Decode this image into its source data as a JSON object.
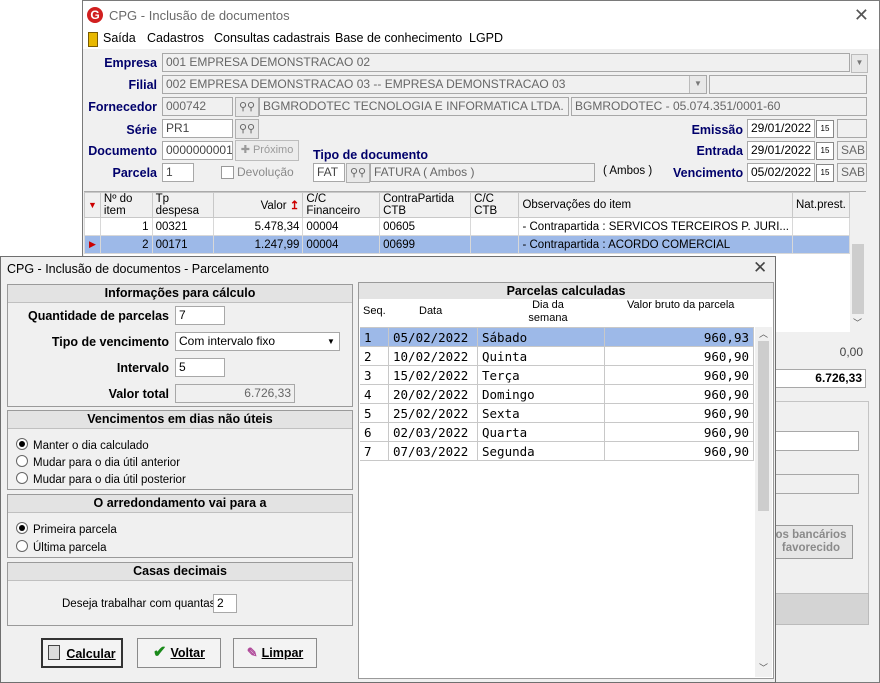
{
  "main": {
    "title": "CPG - Inclusão de documentos",
    "menu": [
      "Saída",
      "Cadastros",
      "Consultas cadastrais",
      "Base de conhecimento",
      "LGPD"
    ],
    "empresa_label": "Empresa",
    "empresa_value": "001 EMPRESA DEMONSTRACAO 02",
    "filial_label": "Filial",
    "filial_value": "002 EMPRESA DEMONSTRACAO 03 -- EMPRESA DEMONSTRACAO 03",
    "fornecedor_label": "Fornecedor",
    "fornecedor_code": "000742",
    "fornecedor_name": "BGMRODOTEC TECNOLOGIA E INFORMATICA LTDA.",
    "fornecedor_doc": "BGMRODOTEC - 05.074.351/0001-60",
    "serie_label": "Série",
    "serie_value": "PR1",
    "documento_label": "Documento",
    "documento_value": "0000000001",
    "proximo_label": "Próximo",
    "parcela_label": "Parcela",
    "parcela_value": "1",
    "devolucao_label": "Devolução",
    "tipo_doc_label": "Tipo de documento",
    "tipo_doc_code": "FAT",
    "tipo_doc_name": "FATURA ( Ambos )",
    "tipo_doc_extra": "( Ambos )",
    "emissao_label": "Emissão",
    "emissao_value": "29/01/2022",
    "entrada_label": "Entrada",
    "entrada_value": "29/01/2022",
    "entrada_day": "SAB",
    "vencimento_label": "Vencimento",
    "vencimento_value": "05/02/2022",
    "vencimento_day": "SAB",
    "cal_icon_text": "15",
    "grid_headers": [
      "Nº do item",
      "Tp despesa",
      "Valor",
      "C/C Financeiro",
      "ContraPartida CTB",
      "C/C CTB",
      "Observações do item",
      "Nat.prest."
    ],
    "grid_rows": [
      [
        "1",
        "00321",
        "5.478,34",
        "00004",
        "00605",
        "",
        "- Contrapartida : SERVICOS TERCEIROS P. JURI...",
        ""
      ],
      [
        "2",
        "00171",
        "1.247,99",
        "00004",
        "00699",
        "",
        "- Contrapartida : ACORDO COMERCIAL",
        ""
      ]
    ],
    "right_value1": "0,00",
    "right_value2": "6.726,33",
    "bank_button": "os bancários\nfavorecido"
  },
  "dialog": {
    "title": "CPG - Inclusão de documentos - Parcelamento",
    "info_header": "Informações para cálculo",
    "qtd_label": "Quantidade de parcelas",
    "qtd_value": "7",
    "tipo_venc_label": "Tipo de vencimento",
    "tipo_venc_value": "Com intervalo fixo",
    "intervalo_label": "Intervalo",
    "intervalo_value": "5",
    "valor_total_label": "Valor total",
    "valor_total_value": "6.726,33",
    "venc_header": "Vencimentos em dias não úteis",
    "venc_options": [
      "Manter o dia calculado",
      "Mudar para o dia útil anterior",
      "Mudar para o dia útil posterior"
    ],
    "arred_header": "O arredondamento vai para a",
    "arred_options": [
      "Primeira parcela",
      "Última parcela"
    ],
    "casas_header": "Casas decimais",
    "casas_label": "Deseja trabalhar com quantas",
    "casas_value": "2",
    "btn_calcular": "Calcular",
    "btn_voltar": "Voltar",
    "btn_limpar": "Limpar",
    "parcelas_header": "Parcelas calculadas",
    "parcelas_cols": [
      "Seq.",
      "Data",
      "Dia da semana",
      "Valor bruto da parcela"
    ],
    "parcelas": [
      {
        "seq": "1",
        "data": "05/02/2022",
        "dia": "Sábado",
        "valor": "960,93"
      },
      {
        "seq": "2",
        "data": "10/02/2022",
        "dia": "Quinta",
        "valor": "960,90"
      },
      {
        "seq": "3",
        "data": "15/02/2022",
        "dia": "Terça",
        "valor": "960,90"
      },
      {
        "seq": "4",
        "data": "20/02/2022",
        "dia": "Domingo",
        "valor": "960,90"
      },
      {
        "seq": "5",
        "data": "25/02/2022",
        "dia": "Sexta",
        "valor": "960,90"
      },
      {
        "seq": "6",
        "data": "02/03/2022",
        "dia": "Quarta",
        "valor": "960,90"
      },
      {
        "seq": "7",
        "data": "07/03/2022",
        "dia": "Segunda",
        "valor": "960,90"
      }
    ]
  },
  "colors": {
    "selection": "#9db9e8",
    "label_blue": "#00006b",
    "brand_red": "#d11f1f"
  }
}
